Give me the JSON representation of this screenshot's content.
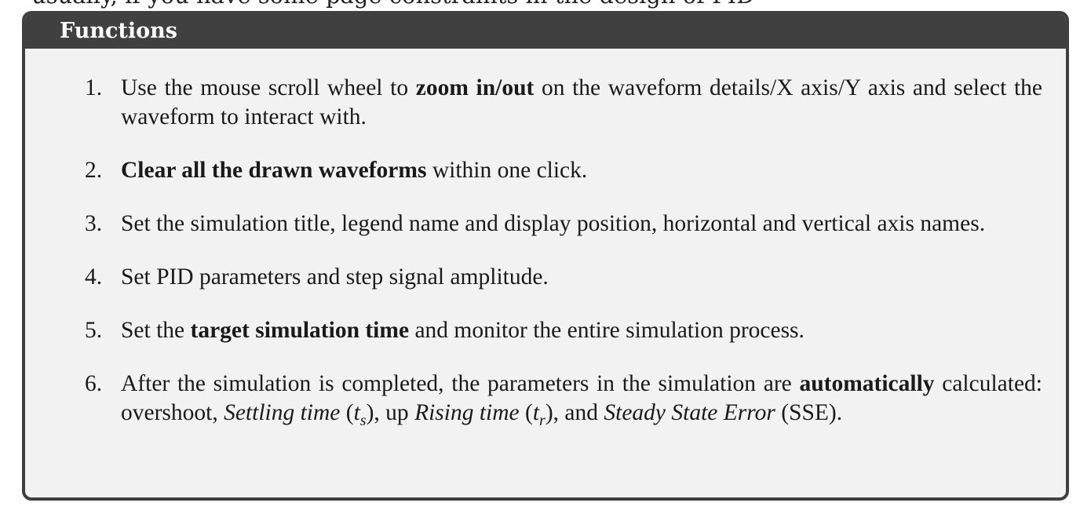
{
  "header_cut_text": "usually, if you have some page constraints in the design of PID",
  "box": {
    "title": "Functions"
  },
  "items": [
    {
      "num": "1.",
      "t1": "Use the mouse scroll wheel to ",
      "b1": "zoom in/out",
      "t2": " on the waveform details/X axis/Y axis and select the waveform to interact with."
    },
    {
      "num": "2.",
      "b1": "Clear all the drawn waveforms",
      "t2": " within one click."
    },
    {
      "num": "3.",
      "t1": "Set the simulation title, legend name and display position, horizontal and vertical axis names."
    },
    {
      "num": "4.",
      "t1": "Set PID parameters and step signal amplitude."
    },
    {
      "num": "5.",
      "t1": "Set the ",
      "b1": "target simulation time",
      "t2": " and monitor the entire simulation process."
    },
    {
      "num": "6.",
      "t1": "After the simulation is completed, the parameters in the simulation are ",
      "b1": "automati­cally",
      "t2": " calculated: overshoot, ",
      "i1": "Settling time",
      "t3": " (",
      "m1": "t",
      "m1sub": "s",
      "t4": "), up ",
      "i2": "Rising time",
      "t5": " (",
      "m2": "t",
      "m2sub": "r",
      "t6": "), and ",
      "i3": "Steady State Error",
      "t7": " (SSE)."
    }
  ]
}
